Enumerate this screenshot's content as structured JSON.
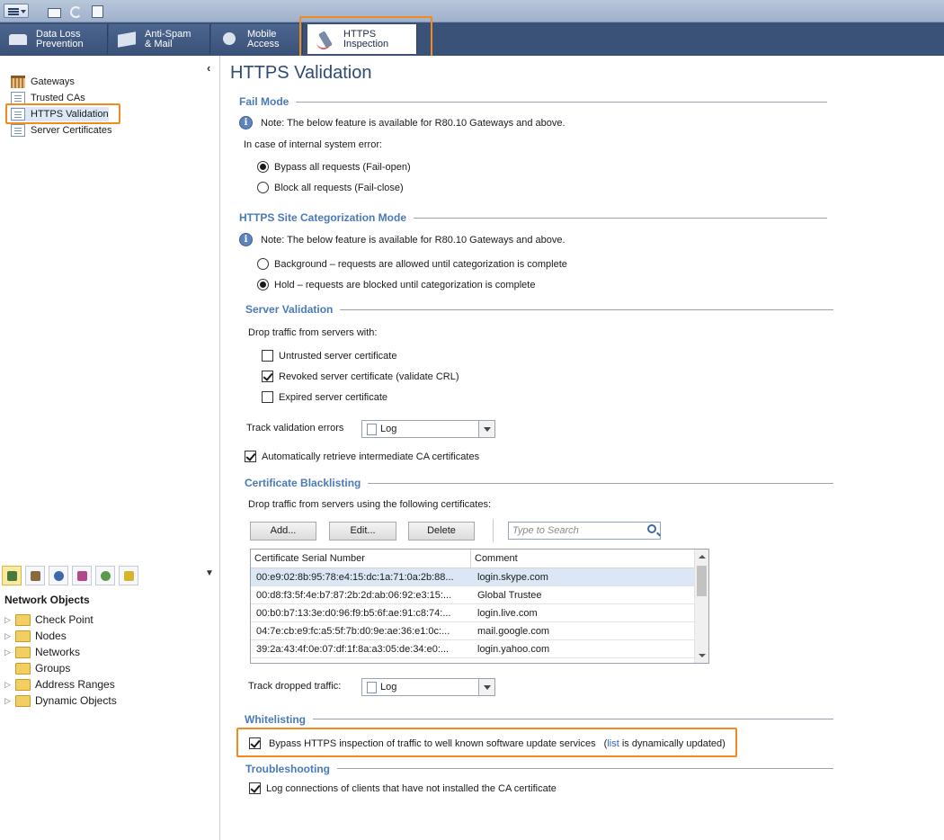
{
  "tabs": [
    {
      "label": "Data Loss\nPrevention",
      "icon": "faucet-icon"
    },
    {
      "label": "Anti-Spam\n& Mail",
      "icon": "mail-icon"
    },
    {
      "label": "Mobile\nAccess",
      "icon": "satellite-dish-icon"
    },
    {
      "label": "HTTPS\nInspection",
      "icon": "microscope-icon"
    }
  ],
  "sidebar": {
    "items": [
      {
        "label": "Gateways",
        "icon": "gateway-icon"
      },
      {
        "label": "Trusted CAs",
        "icon": "document-icon"
      },
      {
        "label": "HTTPS Validation",
        "icon": "document-icon"
      },
      {
        "label": "Server Certificates",
        "icon": "document-icon"
      }
    ]
  },
  "network_objects": {
    "title": "Network Objects",
    "items": [
      {
        "label": "Check Point"
      },
      {
        "label": "Nodes"
      },
      {
        "label": "Networks"
      },
      {
        "label": "Groups"
      },
      {
        "label": "Address Ranges"
      },
      {
        "label": "Dynamic Objects"
      }
    ]
  },
  "page": {
    "title": "HTTPS Validation"
  },
  "fail_mode": {
    "title": "Fail Mode",
    "note": "Note: The below feature is available for R80.10 Gateways and above.",
    "prompt": "In case of internal system error:",
    "options": [
      "Bypass all requests (Fail-open)",
      "Block all requests (Fail-close)"
    ],
    "selected": 0
  },
  "categorization": {
    "title": "HTTPS Site Categorization Mode",
    "note": "Note: The below feature is available for R80.10 Gateways and above.",
    "options": [
      "Background – requests are allowed until categorization is complete",
      "Hold – requests are blocked until categorization is complete"
    ],
    "selected": 1
  },
  "server_validation": {
    "title": "Server Validation",
    "prompt": "Drop traffic from servers with:",
    "checks": [
      {
        "label": "Untrusted server certificate",
        "checked": false
      },
      {
        "label": "Revoked server certificate (validate CRL)",
        "checked": true
      },
      {
        "label": "Expired server certificate",
        "checked": false
      }
    ],
    "track_label": "Track validation errors",
    "track_value": "Log",
    "auto_retrieve": {
      "label": "Automatically retrieve intermediate CA certificates",
      "checked": true
    }
  },
  "blacklisting": {
    "title": "Certificate Blacklisting",
    "prompt": "Drop traffic from servers using the following certificates:",
    "buttons": {
      "add": "Add...",
      "edit": "Edit...",
      "delete": "Delete"
    },
    "search_placeholder": "Type to Search",
    "columns": [
      "Certificate Serial Number",
      "Comment"
    ],
    "rows": [
      [
        "00:e9:02:8b:95:78:e4:15:dc:1a:71:0a:2b:88...",
        "login.skype.com"
      ],
      [
        "00:d8:f3:5f:4e:b7:87:2b:2d:ab:06:92:e3:15:...",
        "Global Trustee"
      ],
      [
        "00:b0:b7:13:3e:d0:96:f9:b5:6f:ae:91:c8:74:...",
        "login.live.com"
      ],
      [
        "04:7e:cb:e9:fc:a5:5f:7b:d0:9e:ae:36:e1:0c:...",
        "mail.google.com"
      ],
      [
        "39:2a:43:4f:0e:07:df:1f:8a:a3:05:de:34:e0:...",
        "login.yahoo.com"
      ]
    ],
    "track_label": "Track dropped traffic:",
    "track_value": "Log"
  },
  "whitelisting": {
    "title": "Whitelisting",
    "bypass_prefix": "Bypass HTTPS inspection of traffic to well known software update services",
    "paren_open": "(",
    "link": "list",
    "bypass_suffix": "is dynamically updated)",
    "checked": true
  },
  "troubleshooting": {
    "title": "Troubleshooting",
    "log_label": "Log connections of clients that have not installed the CA certificate",
    "checked": true
  },
  "colors": {
    "accent": "#f28a20",
    "section": "#4a7ab8",
    "tabbar": "#3b5278"
  }
}
